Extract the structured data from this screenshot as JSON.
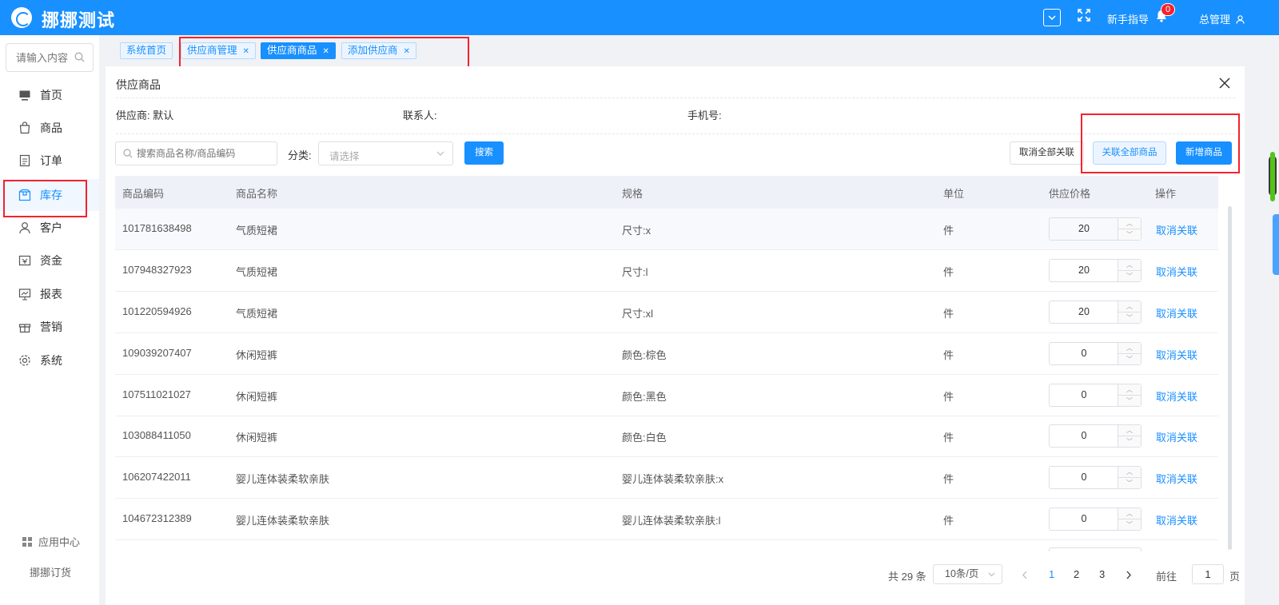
{
  "header": {
    "brand": "挪挪测试",
    "guide": "新手指导",
    "notification_count": "0",
    "user": "总管理"
  },
  "sidebar": {
    "search_placeholder": "请输入内容",
    "items": [
      {
        "label": "首页",
        "icon": "monitor-icon"
      },
      {
        "label": "商品",
        "icon": "bag-icon"
      },
      {
        "label": "订单",
        "icon": "document-icon"
      },
      {
        "label": "库存",
        "icon": "box-icon",
        "active": true
      },
      {
        "label": "客户",
        "icon": "user-icon"
      },
      {
        "label": "资金",
        "icon": "wallet-icon"
      },
      {
        "label": "报表",
        "icon": "chart-icon"
      },
      {
        "label": "营销",
        "icon": "gift-icon"
      },
      {
        "label": "系统",
        "icon": "gear-icon"
      }
    ],
    "app_center": "应用中心",
    "footer_brand": "挪挪订货"
  },
  "tags": [
    {
      "label": "系统首页",
      "closable": false
    },
    {
      "label": "供应商管理",
      "closable": true
    },
    {
      "label": "供应商商品",
      "closable": true,
      "active": true
    },
    {
      "label": "添加供应商",
      "closable": true
    }
  ],
  "panel": {
    "title": "供应商品",
    "supplier_label": "供应商: 默认",
    "contact_label": "联系人:",
    "phone_label": "手机号:"
  },
  "toolbar": {
    "search_placeholder": "搜索商品名称/商品编码",
    "category_label": "分类:",
    "category_placeholder": "请选择",
    "search_button": "搜索",
    "unlink_all_button": "取消全部关联",
    "link_all_button": "关联全部商品",
    "add_button": "新增商品"
  },
  "table": {
    "columns": [
      "商品编码",
      "商品名称",
      "规格",
      "单位",
      "供应价格",
      "操作"
    ],
    "rows": [
      {
        "code": "101781638498",
        "name": "气质短裙",
        "spec": "尺寸:x",
        "unit": "件",
        "price": "20",
        "action": "取消关联"
      },
      {
        "code": "107948327923",
        "name": "气质短裙",
        "spec": "尺寸:l",
        "unit": "件",
        "price": "20",
        "action": "取消关联"
      },
      {
        "code": "101220594926",
        "name": "气质短裙",
        "spec": "尺寸:xl",
        "unit": "件",
        "price": "20",
        "action": "取消关联"
      },
      {
        "code": "109039207407",
        "name": "休闲短裤",
        "spec": "颜色:棕色",
        "unit": "件",
        "price": "0",
        "action": "取消关联"
      },
      {
        "code": "107511021027",
        "name": "休闲短裤",
        "spec": "颜色:黑色",
        "unit": "件",
        "price": "0",
        "action": "取消关联"
      },
      {
        "code": "103088411050",
        "name": "休闲短裤",
        "spec": "颜色:白色",
        "unit": "件",
        "price": "0",
        "action": "取消关联"
      },
      {
        "code": "106207422011",
        "name": "婴儿连体装柔软亲肤",
        "spec": "婴儿连体装柔软亲肤:x",
        "unit": "件",
        "price": "0",
        "action": "取消关联"
      },
      {
        "code": "104672312389",
        "name": "婴儿连体装柔软亲肤",
        "spec": "婴儿连体装柔软亲肤:l",
        "unit": "件",
        "price": "0",
        "action": "取消关联"
      }
    ]
  },
  "pagination": {
    "total": "共 29 条",
    "page_size": "10条/页",
    "pages": [
      "1",
      "2",
      "3"
    ],
    "current": "1",
    "goto_label": "前往",
    "goto_value": "1",
    "page_suffix": "页"
  },
  "colors": {
    "primary": "#1890ff",
    "highlight_box": "#f5222d",
    "badge": "#f5222d"
  }
}
